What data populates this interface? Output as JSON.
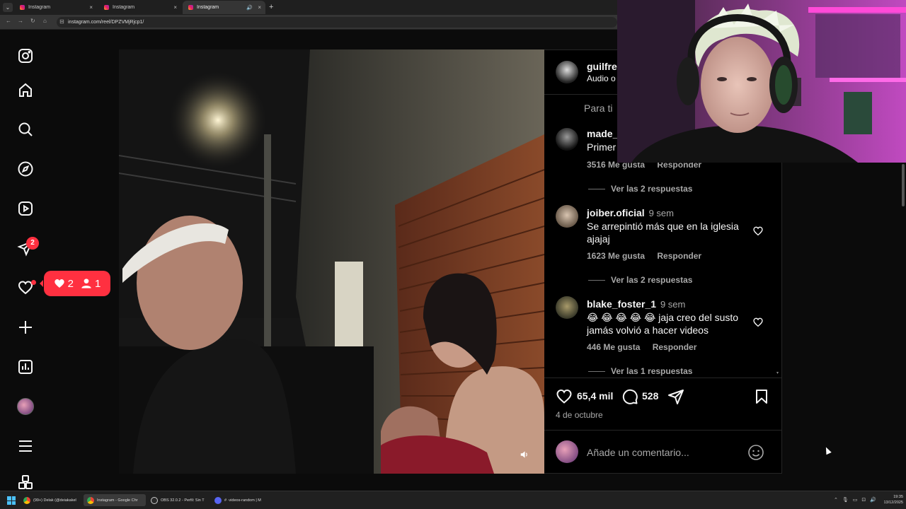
{
  "browser": {
    "tabs": [
      {
        "label": "Instagram",
        "close": "×"
      },
      {
        "label": "Instagram",
        "close": "×"
      },
      {
        "label": "Instagram",
        "close": "×"
      }
    ],
    "new_tab": "+",
    "url": "instagram.com/reel/DPZVMjRjcp1/",
    "nav_back": "←",
    "nav_forward": "→",
    "nav_reload": "↻",
    "nav_home": "⌂",
    "tune_icon": "⊟",
    "speaker_icon": "🔊"
  },
  "sidebar": {
    "badge_count": "2"
  },
  "notification_pill": {
    "likes": "2",
    "follows": "1"
  },
  "reel": {
    "author": "guilfre",
    "audio": "Audio o",
    "sort_label": "Para ti",
    "likes": "65,4 mil",
    "comments_count": "528",
    "date": "4 de octubre",
    "comment_placeholder": "Añade un comentario..."
  },
  "comments": [
    {
      "user": "made_",
      "time": "",
      "text": "Primer",
      "likes": "3516 Me gusta",
      "reply": "Responder",
      "replies": "Ver las 2 respuestas"
    },
    {
      "user": "joiber.oficial",
      "time": "9 sem",
      "text": "Se arrepintió más que en la iglesia ajajaj",
      "likes": "1623 Me gusta",
      "reply": "Responder",
      "replies": "Ver las 2 respuestas"
    },
    {
      "user": "blake_foster_1",
      "time": "9 sem",
      "text": "😂 😂 😂 😂 😂 jaja creo del susto jamás volvió a hacer videos",
      "likes": "446 Me gusta",
      "reply": "Responder",
      "replies": "Ver las 1 respuestas"
    }
  ],
  "taskbar": {
    "items": [
      "(99+) Delak (@deiakakel",
      "Instagram - Google Chr",
      "OBS 32.0.2 - Perfil: Sin T",
      "# ·videos-random | M"
    ],
    "time": "19:35",
    "date": "13/12/2025"
  },
  "colors": {
    "badge": "#ff3040",
    "background": "#0b0b0b",
    "panel": "#000000"
  },
  "icons": [
    "instagram-logo-icon",
    "home-icon",
    "search-icon",
    "explore-icon",
    "reels-icon",
    "messages-icon",
    "heart-icon",
    "create-icon",
    "dashboard-icon",
    "profile-avatar",
    "menu-icon",
    "apps-icon"
  ]
}
